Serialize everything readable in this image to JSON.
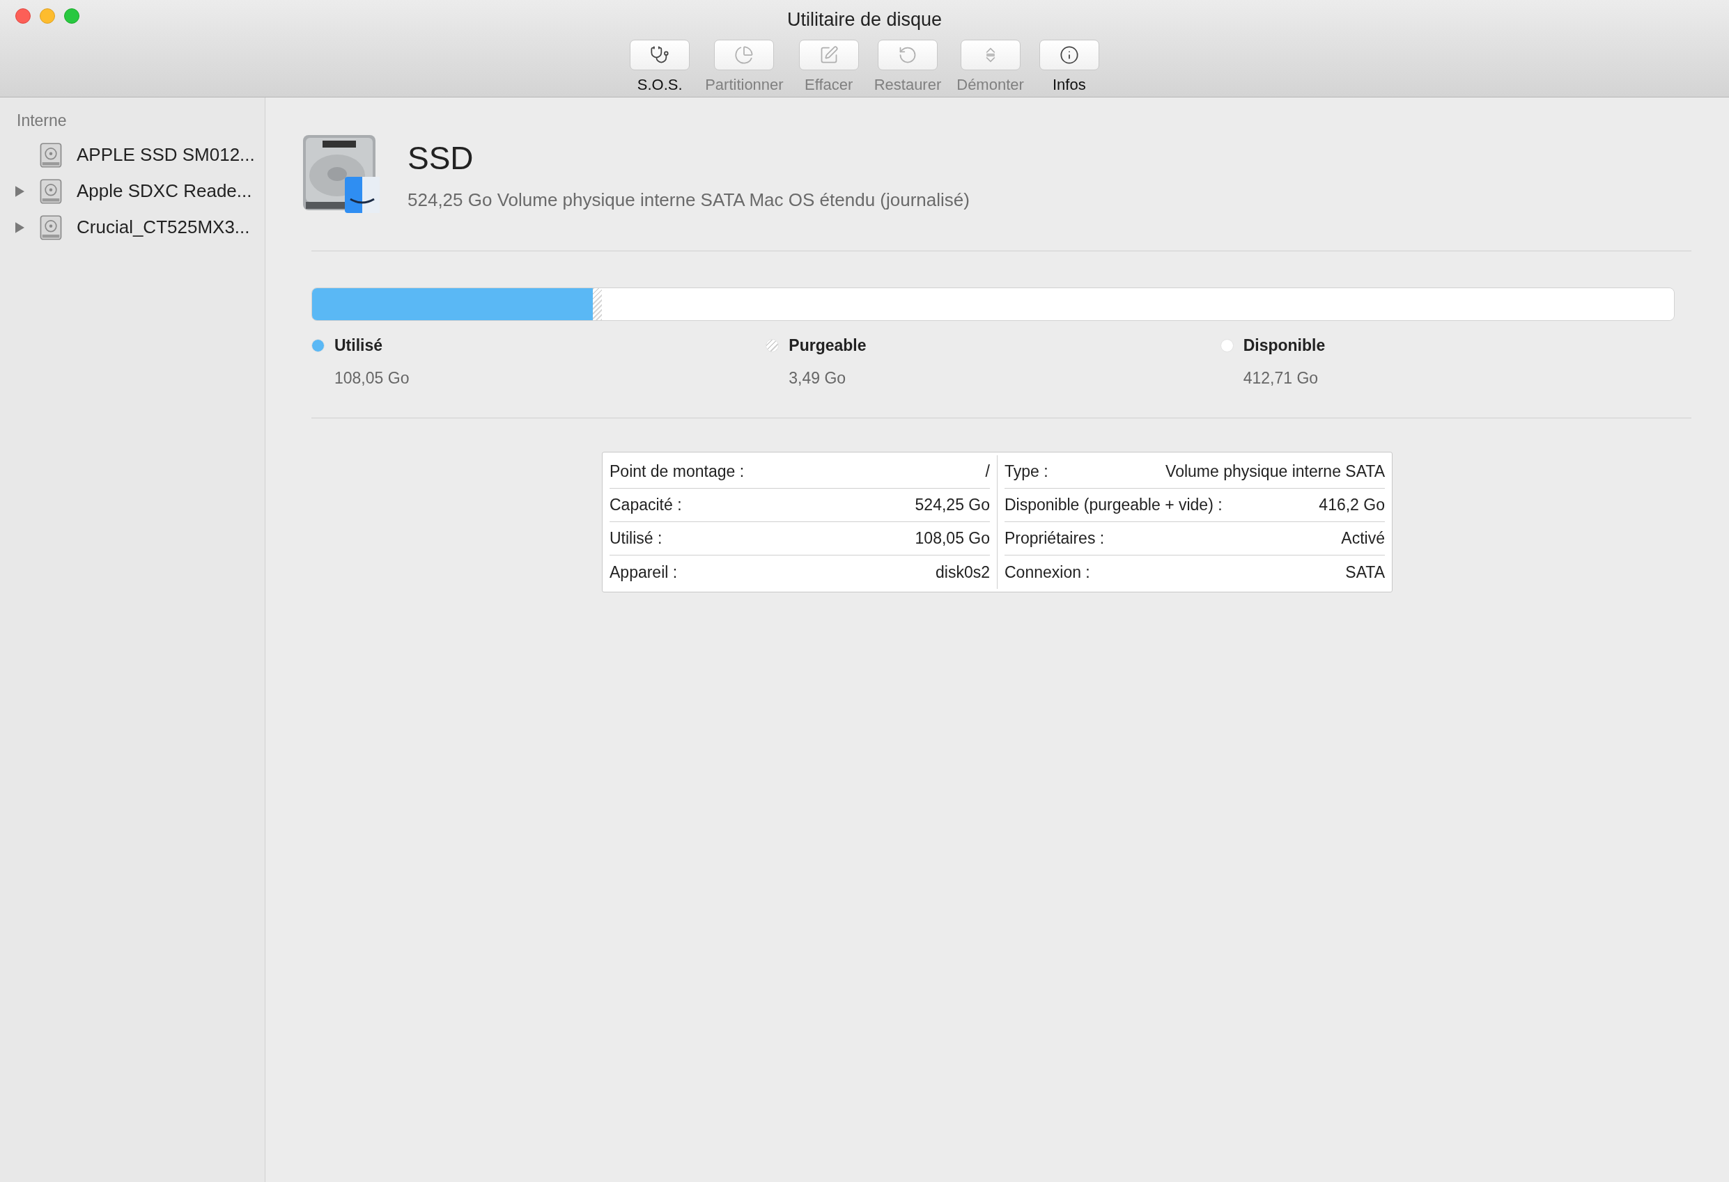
{
  "window": {
    "title": "Utilitaire de disque"
  },
  "toolbar": [
    {
      "kind": "sos",
      "label": "S.O.S.",
      "disabled": false
    },
    {
      "kind": "partition",
      "label": "Partitionner",
      "disabled": true
    },
    {
      "kind": "erase",
      "label": "Effacer",
      "disabled": true
    },
    {
      "kind": "restore",
      "label": "Restaurer",
      "disabled": true
    },
    {
      "kind": "unmount",
      "label": "Démonter",
      "disabled": true
    },
    {
      "kind": "info",
      "label": "Infos",
      "disabled": false
    }
  ],
  "sidebar": {
    "heading": "Interne",
    "items": [
      {
        "label": "APPLE SSD SM012...",
        "expandable": false
      },
      {
        "label": "Apple SDXC Reade...",
        "expandable": true
      },
      {
        "label": "Crucial_CT525MX3...",
        "expandable": true
      }
    ]
  },
  "volume": {
    "name": "SSD",
    "description": "524,25 Go Volume physique interne SATA Mac OS étendu (journalisé)"
  },
  "usage": [
    {
      "label": "Utilisé",
      "value": "108,05 Go",
      "level": 0.206,
      "color": "#5ab8f5",
      "kind": "solid"
    },
    {
      "label": "Purgeable",
      "value": "3,49 Go",
      "level": 0.007,
      "color": "#ffffff",
      "kind": "hatched"
    },
    {
      "label": "Disponible",
      "value": "412,71 Go",
      "level": 0.787,
      "color": "#ffffff",
      "kind": "solid"
    }
  ],
  "info": {
    "left": [
      {
        "label": "Point de montage :",
        "value": "/"
      },
      {
        "label": "Capacité :",
        "value": "524,25 Go"
      },
      {
        "label": "Utilisé :",
        "value": "108,05 Go"
      },
      {
        "label": "Appareil :",
        "value": "disk0s2"
      }
    ],
    "right": [
      {
        "label": "Type :",
        "value": "Volume physique interne SATA"
      },
      {
        "label": "Disponible (purgeable + vide) :",
        "value": "416,2 Go"
      },
      {
        "label": "Propriétaires :",
        "value": "Activé"
      },
      {
        "label": "Connexion :",
        "value": "SATA"
      }
    ]
  }
}
